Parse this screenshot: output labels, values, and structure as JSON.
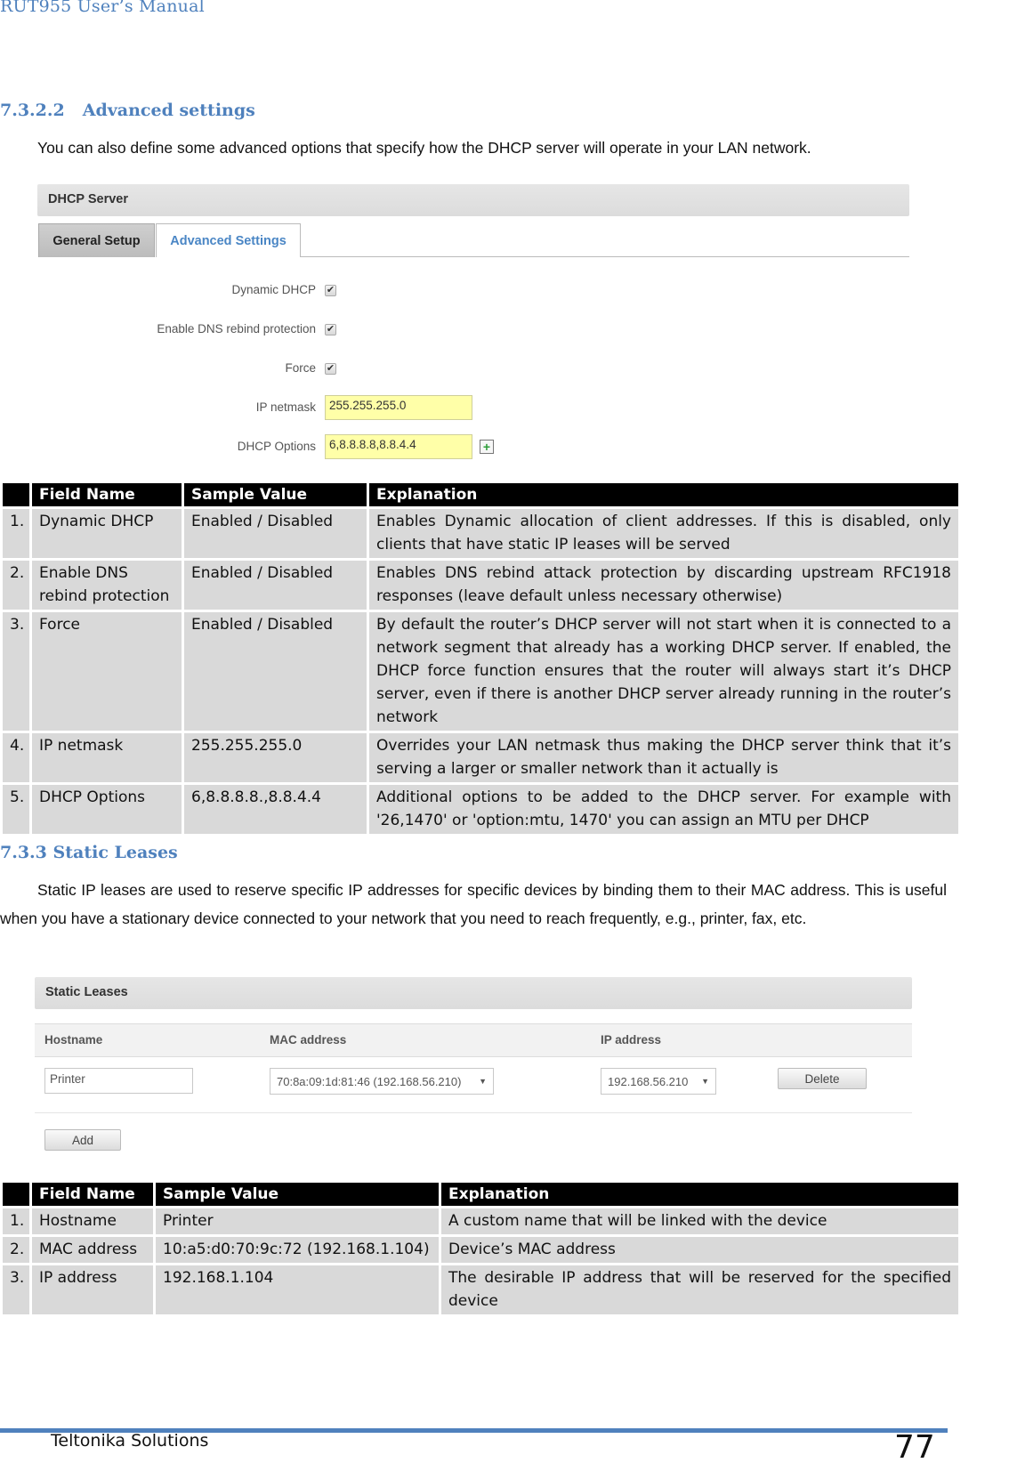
{
  "header": {
    "title": "RUT955 User’s Manual"
  },
  "advanced": {
    "section_number": "7.3.2.2",
    "section_title": "Advanced settings",
    "intro": "You can also define some advanced options that specify how the DHCP server will operate in your LAN network.",
    "screenshot": {
      "panel_title": "DHCP Server",
      "tabs": [
        {
          "label": "General Setup",
          "active": false
        },
        {
          "label": "Advanced Settings",
          "active": true
        }
      ],
      "fields": {
        "dynamic_dhcp": {
          "label": "Dynamic DHCP",
          "checked": true
        },
        "dns_rebind": {
          "label": "Enable DNS rebind protection",
          "checked": true
        },
        "force": {
          "label": "Force",
          "checked": true
        },
        "ip_netmask": {
          "label": "IP netmask",
          "value": "255.255.255.0"
        },
        "dhcp_options": {
          "label": "DHCP Options",
          "value": "6,8.8.8.8,8.8.4.4"
        }
      },
      "check_glyph": "✔",
      "add_glyph": "+"
    },
    "table": {
      "headers": [
        "",
        "Field Name",
        "Sample Value",
        "Explanation"
      ],
      "rows": [
        {
          "num": "1.",
          "field": "Dynamic DHCP",
          "sample": "Enabled / Disabled",
          "explanation": "Enables Dynamic allocation of client addresses. If this is disabled, only clients that have static IP leases will be served"
        },
        {
          "num": "2.",
          "field": "Enable DNS rebind protection",
          "sample": "Enabled / Disabled",
          "explanation": "Enables DNS rebind attack protection by discarding upstream RFC1918 responses (leave default unless necessary otherwise)"
        },
        {
          "num": "3.",
          "field": "Force",
          "sample": "Enabled / Disabled",
          "explanation": "By default the router’s DHCP server will not start when it is connected to a network segment that already has a working DHCP server. If enabled, the DHCP force function ensures that the router will always start it’s DHCP server, even if there is another DHCP server already running in the router’s network"
        },
        {
          "num": "4.",
          "field": "IP netmask",
          "sample": "255.255.255.0",
          "explanation": "Overrides your LAN netmask thus making the DHCP server think that it’s serving a larger or smaller network than it actually is"
        },
        {
          "num": "5.",
          "field": "DHCP Options",
          "sample": "6,8.8.8.8.,8.8.4.4",
          "explanation": "Additional options to be added to the DHCP server. For example with '26,1470' or 'option:mtu, 1470' you can assign an MTU per DHCP"
        }
      ]
    }
  },
  "static_leases": {
    "section_number": "7.3.3",
    "section_title": "Static Leases",
    "intro": "Static IP leases are used to reserve specific IP addresses for specific devices by binding them to their MAC address. This is useful when you have a stationary device connected to your network that you need to reach frequently, e.g., printer, fax, etc.",
    "screenshot": {
      "panel_title": "Static Leases",
      "columns": [
        "Hostname",
        "MAC address",
        "IP address"
      ],
      "row": {
        "hostname": "Printer",
        "mac": "70:8a:09:1d:81:46 (192.168.56.210)",
        "ip": "192.168.56.210",
        "delete_label": "Delete"
      },
      "dropdown_glyph": "▼",
      "add_label": "Add"
    },
    "table": {
      "headers": [
        "",
        "Field Name",
        "Sample Value",
        "Explanation"
      ],
      "rows": [
        {
          "num": "1.",
          "field": "Hostname",
          "sample": "Printer",
          "explanation": "A custom name that will be linked with the device"
        },
        {
          "num": "2.",
          "field": "MAC address",
          "sample": "10:a5:d0:70:9c:72 (192.168.1.104)",
          "explanation": "Device’s MAC address"
        },
        {
          "num": "3.",
          "field": "IP address",
          "sample": "192.168.1.104",
          "explanation": "The desirable IP address that will be reserved for the specified device"
        }
      ]
    }
  },
  "footer": {
    "company": "Teltonika Solutions",
    "page_number": "77"
  }
}
